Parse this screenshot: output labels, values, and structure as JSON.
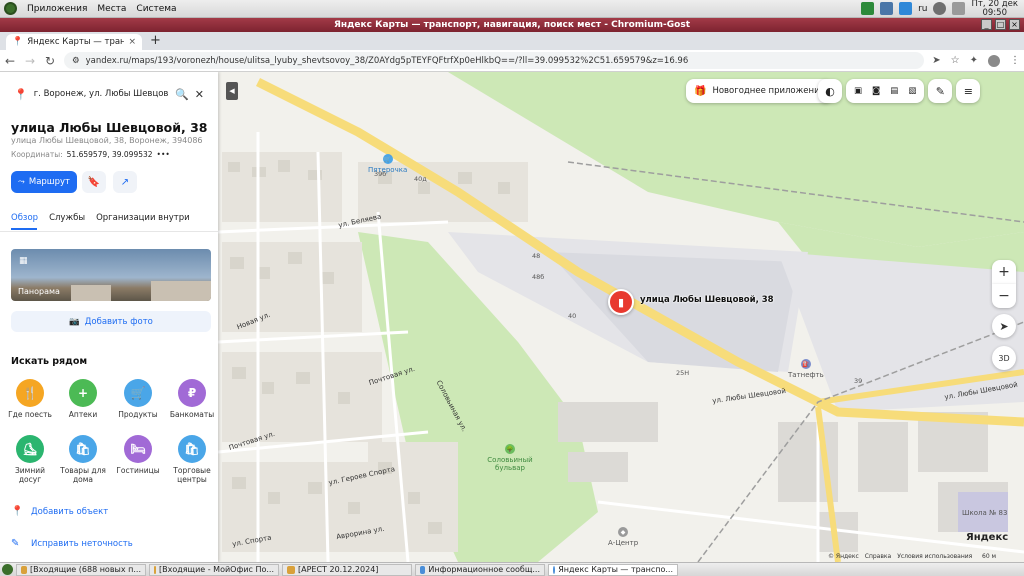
{
  "system_panel": {
    "menu": [
      "Приложения",
      "Места",
      "Система"
    ],
    "keyboard_layout": "ru",
    "clock_day": "Пт, 20 дек",
    "clock_time": "09:50"
  },
  "window": {
    "title": "Яндекс Карты — транспорт, навигация, поиск мест - Chromium-Gost"
  },
  "browser": {
    "tab_title": "Яндекс Карты — транспо...",
    "url": "yandex.ru/maps/193/voronezh/house/ulitsa_lyuby_shevtsovoy_38/Z0AYdg5pTEYFQFtrfXp0eHlkbQ==/?ll=39.099532%2C51.659579&z=16.96"
  },
  "sidebar": {
    "search_query": "г. Воронеж, ул. Любы Шевцовой",
    "title": "улица Любы Шевцовой, 38",
    "subtitle": "улица Любы Шевцовой, 38, Воронеж, 394086",
    "coords_label": "Координаты:",
    "coords_value": "51.659579, 39.099532",
    "more": "•••",
    "route_label": "Маршрут",
    "tabs": [
      "Обзор",
      "Службы",
      "Организации внутри"
    ],
    "panorama_label": "Панорама",
    "add_photo_label": "Добавить фото",
    "nearby_title": "Искать рядом",
    "categories": [
      {
        "label": "Где поесть",
        "color": "#f5a623",
        "glyph": "🍴"
      },
      {
        "label": "Аптеки",
        "color": "#4cba55",
        "glyph": "+"
      },
      {
        "label": "Продукты",
        "color": "#4aa6e8",
        "glyph": "🛒"
      },
      {
        "label": "Банкоматы",
        "color": "#a16ad6",
        "glyph": "₽"
      },
      {
        "label": "Зимний досуг",
        "color": "#2bb56f",
        "glyph": "⛸"
      },
      {
        "label": "Товары для дома",
        "color": "#4aa6e8",
        "glyph": "🛍"
      },
      {
        "label": "Гостиницы",
        "color": "#a16ad6",
        "glyph": "🛏"
      },
      {
        "label": "Торговые центры",
        "color": "#4aa6e8",
        "glyph": "🛍"
      }
    ],
    "add_object": "Добавить объект",
    "fix_error": "Исправить неточность"
  },
  "map": {
    "new_year_chip": "Новогоднее приложение",
    "marker_label": "улица Любы Шевцовой, 38",
    "streets": {
      "lyuby_shevtsovoy": "ул. Любы Шевцовой",
      "belyaeva": "ул. Беляева",
      "novaya": "Новая ул.",
      "pochtovaya": "Почтовая ул.",
      "pochtovaya2": "Почтовая ул.",
      "solovinaya": "Соловьиная ул.",
      "geroev_sporta": "ул. Героев Спорта",
      "avrorina": "Аврорина ул.",
      "sporta": "ул. Спорта"
    },
    "pois": {
      "pyaterochka": "Пятерочка",
      "tatneft": "Татнефть",
      "solovinyi_bulvar": "Соловьиный бульвар",
      "a_center": "А-Центр",
      "school": "Школа № 83"
    },
    "house_numbers": [
      "39б",
      "40д",
      "48",
      "48б",
      "40",
      "25Н",
      "39"
    ],
    "copyright": [
      "© Яндекс",
      "Справка",
      "Условия использования"
    ],
    "logo": "Яндекс",
    "scale": "60 м"
  },
  "taskbar": {
    "items": [
      "[Входящие (688 новых п...",
      "[Входящие - МойОфис По...",
      "[АРЕСТ 20.12.2024]",
      "Информационное сообщ...",
      "Яндекс Карты — транспо..."
    ]
  },
  "colors": {
    "accent": "#1e6cf2",
    "marker": "#e8392f",
    "window_title": "#8e2d3a",
    "park": "#cde8b6",
    "road": "#f7dc7a"
  }
}
